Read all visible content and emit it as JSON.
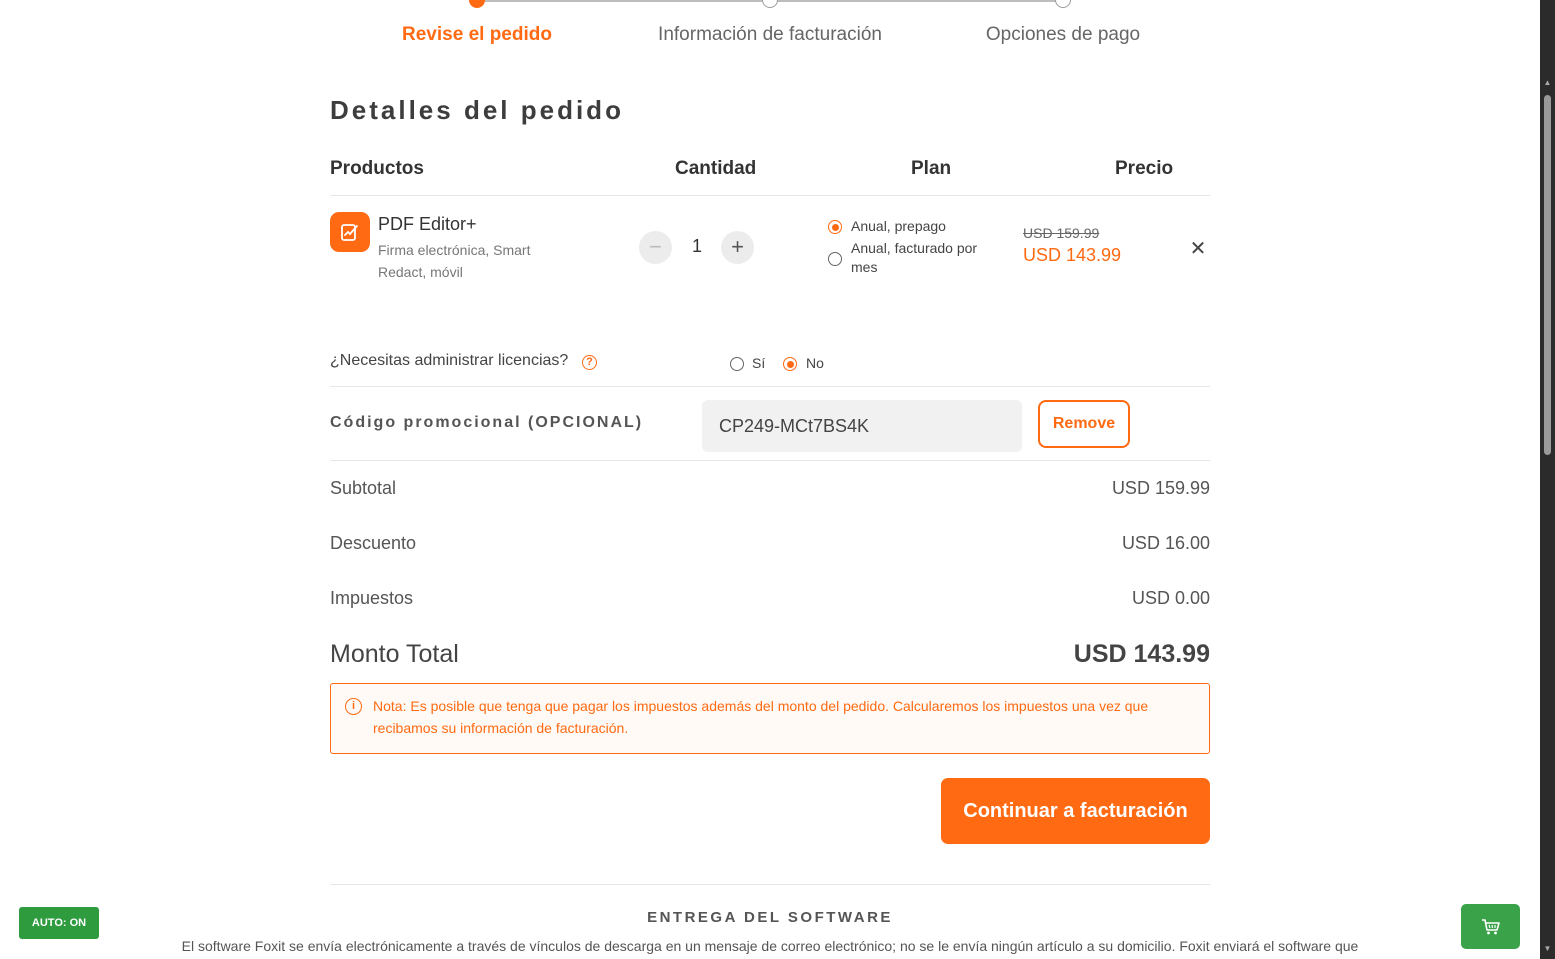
{
  "stepper": {
    "steps": [
      {
        "label": "Revise el pedido",
        "active": true
      },
      {
        "label": "Información de facturación",
        "active": false
      },
      {
        "label": "Opciones de pago",
        "active": false
      }
    ]
  },
  "order": {
    "title": "Detalles del pedido",
    "columns": {
      "products": "Productos",
      "quantity": "Cantidad",
      "plan": "Plan",
      "price": "Precio"
    },
    "item": {
      "name": "PDF Editor+",
      "description": "Firma electrónica, Smart Redact, móvil",
      "quantity": "1",
      "plan_options": [
        {
          "label": "Anual, prepago",
          "selected": true
        },
        {
          "label": "Anual, facturado por mes",
          "selected": false
        }
      ],
      "price_original": "USD 159.99",
      "price_current": "USD 143.99"
    }
  },
  "licenses": {
    "question": "¿Necesitas administrar licencias?",
    "help_glyph": "?",
    "options": [
      {
        "label": "Sí",
        "selected": false
      },
      {
        "label": "No",
        "selected": true
      }
    ]
  },
  "promo": {
    "label": "Código promocional (OPCIONAL)",
    "value": "CP249-MCt7BS4K",
    "remove_label": "Remove"
  },
  "summary": {
    "subtotal_label": "Subtotal",
    "subtotal_value": "USD 159.99",
    "discount_label": "Descuento",
    "discount_value": "USD 16.00",
    "tax_label": "Impuestos",
    "tax_value": "USD 0.00",
    "total_label": "Monto Total",
    "total_value": "USD 143.99"
  },
  "note": {
    "icon_glyph": "i",
    "text": "Nota: Es posible que tenga que pagar los impuestos además del monto del pedido. Calcularemos los impuestos una vez que recibamos su información de facturación."
  },
  "continue_label": "Continuar a facturación",
  "delivery": {
    "title": "ENTREGA DEL SOFTWARE",
    "text": "El software Foxit se envía electrónicamente a través de vínculos de descarga en un mensaje de correo electrónico; no se le envía ningún artículo a su domicilio. Foxit enviará el software que"
  },
  "auto_badge": "AUTO: ON",
  "colors": {
    "accent": "#ff6a13",
    "green": "#3aa34a"
  }
}
